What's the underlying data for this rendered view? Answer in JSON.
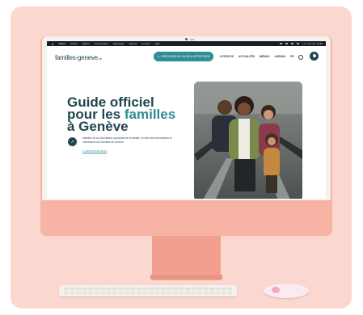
{
  "menubar": {
    "app": "Safari",
    "items": [
      "Fichier",
      "Édition",
      "Présentation",
      "Historique",
      "Signets",
      "Fenêtre",
      "Aide"
    ],
    "clock": "Lun. 14 nov. 10:30"
  },
  "site": {
    "logo": "familles-geneve",
    "logo_domain": ".ch",
    "cta_label": "PARCOURIR EN UN SEUL REPERTOIRE",
    "nav": [
      "À PROPOS",
      "ACTUALITÉS",
      "MÉDIAS",
      "AGENDA",
      "FR"
    ],
    "hero_title_line1": "Guide officiel",
    "hero_title_line2_prefix": "pour les ",
    "hero_title_line2_accent": "familles",
    "hero_title_line3": "à Genève",
    "intro_text": "Initiative de la Commission cantonale de la famille, ce site offre informations et orientations aux familles de Genève",
    "intro_link": "À PROPOS DE NOUS"
  },
  "colors": {
    "background_card": "#fbd8cf",
    "imac_pink": "#f6b3a4",
    "brand_dark": "#1f4650",
    "brand_teal": "#2d8e93"
  },
  "icons": {
    "search": "search-icon",
    "user": "user-icon",
    "arrow": "arrow-icon"
  }
}
